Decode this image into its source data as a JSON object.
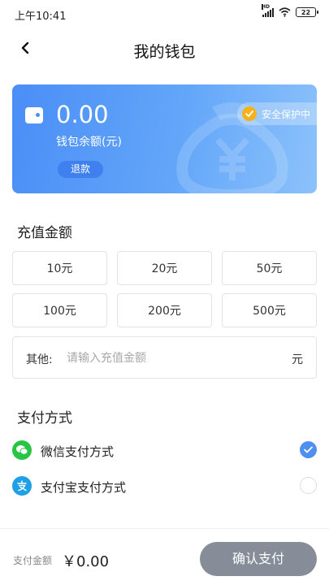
{
  "status_bar": {
    "time": "上午10:41",
    "network": "HD",
    "battery": "22"
  },
  "header": {
    "title": "我的钱包",
    "back_icon": "chevron-left-icon"
  },
  "wallet": {
    "balance": "0.00",
    "balance_label": "钱包余额(元)",
    "refund_label": "退款",
    "security_label": "安全保护中"
  },
  "recharge": {
    "title": "充值金额",
    "amounts": [
      "10元",
      "20元",
      "50元",
      "100元",
      "200元",
      "500元"
    ],
    "other_label": "其他:",
    "other_placeholder": "请输入充值金额",
    "other_unit": "元"
  },
  "payment": {
    "title": "支付方式",
    "methods": [
      {
        "label": "微信支付方式",
        "icon": "wechat-pay-icon",
        "selected": true
      },
      {
        "label": "支付宝支付方式",
        "icon": "alipay-icon",
        "selected": false
      }
    ]
  },
  "footer": {
    "amount_label": "支付金额",
    "amount": "￥0.00",
    "confirm_label": "确认支付"
  },
  "colors": {
    "primary_blue": "#4a8ef7",
    "wechat_green": "#28c445",
    "alipay_blue": "#1e9fe6",
    "confirm_gray": "#878d98",
    "badge_gold": "#f5b21d"
  }
}
